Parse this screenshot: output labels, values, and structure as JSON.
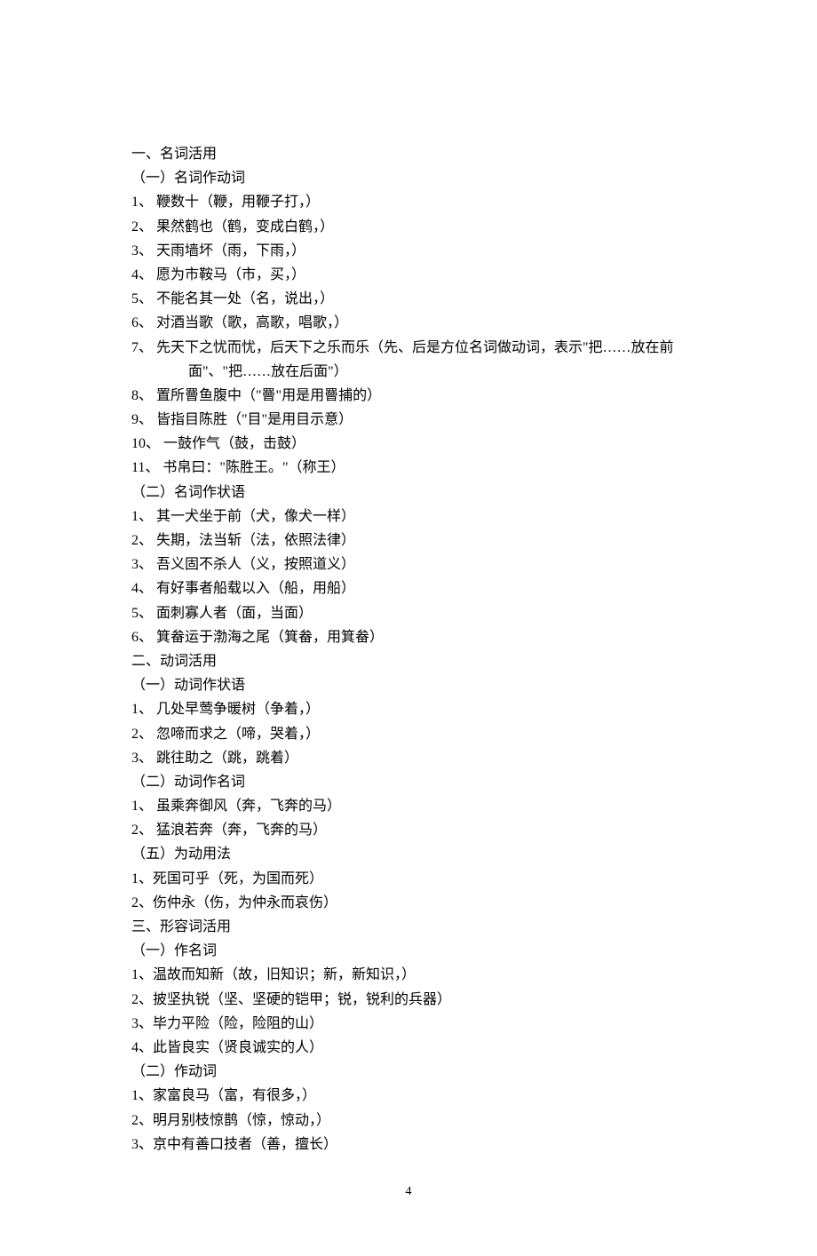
{
  "sections": [
    {
      "heading": "一、名词活用",
      "subsections": [
        {
          "heading": "（一）名词作动词",
          "items": [
            {
              "num": "1、",
              "text": "鞭数十（鞭，用鞭子打，）"
            },
            {
              "num": "2、",
              "text": "果然鹤也（鹤，变成白鹤，）"
            },
            {
              "num": "3、",
              "text": "天雨墙坏（雨，下雨，）"
            },
            {
              "num": "4、",
              "text": "愿为市鞍马（市，买，）"
            },
            {
              "num": "5、",
              "text": "不能名其一处（名，说出，）"
            },
            {
              "num": "6、",
              "text": "对酒当歌（歌，高歌，唱歌，）"
            },
            {
              "num": "7、",
              "text": "先天下之忧而忧，后天下之乐而乐（先、后是方位名词做动词，表示\"把……放在前",
              "cont": "面\"、\"把……放在后面\"）"
            },
            {
              "num": "8、",
              "text": "置所罾鱼腹中（\"罾\"用是用罾捕的）"
            },
            {
              "num": "9、",
              "text": "皆指目陈胜（\"目\"是用目示意）"
            },
            {
              "num": "10、",
              "text": "一鼓作气（鼓，击鼓）"
            },
            {
              "num": "11、",
              "text": "书帛曰：\"陈胜王。\"（称王）"
            }
          ]
        },
        {
          "heading": "（二）名词作状语",
          "items": [
            {
              "num": "1、",
              "text": "其一犬坐于前（犬，像犬一样）"
            },
            {
              "num": "2、",
              "text": "失期，法当斩（法，依照法律）"
            },
            {
              "num": "3、",
              "text": "吾义固不杀人（义，按照道义）"
            },
            {
              "num": "4、",
              "text": "有好事者船载以入（船，用船）"
            },
            {
              "num": "5、",
              "text": "面刺寡人者（面，当面）"
            },
            {
              "num": "6、",
              "text": "箕畚运于渤海之尾（箕畚，用箕畚）"
            }
          ]
        }
      ]
    },
    {
      "heading": "二、动词活用",
      "subsections": [
        {
          "heading": "（一）动词作状语",
          "items": [
            {
              "num": "1、",
              "text": "几处早莺争暖树（争着，）"
            },
            {
              "num": "2、",
              "text": "忽啼而求之（啼，哭着，）"
            },
            {
              "num": "3、",
              "text": "跳往助之（跳，跳着）"
            }
          ]
        },
        {
          "heading": "（二）动词作名词",
          "items": [
            {
              "num": "1、",
              "text": "虽乘奔御风（奔，飞奔的马）"
            },
            {
              "num": "2、",
              "text": "猛浪若奔（奔，飞奔的马）"
            }
          ]
        },
        {
          "heading": "（五）为动用法",
          "items": [
            {
              "num": "1、",
              "text": "死国可乎（死，为国而死）",
              "flat": true
            },
            {
              "num": "2、",
              "text": "伤仲永（伤，为仲永而哀伤）",
              "flat": true
            }
          ]
        }
      ]
    },
    {
      "heading": "三、形容词活用",
      "subsections": [
        {
          "heading": "（一）作名词",
          "items": [
            {
              "num": "1、",
              "text": "温故而知新（故，旧知识；新，新知识，）",
              "flat": true
            },
            {
              "num": "2、",
              "text": "披坚执锐（坚、坚硬的铠甲；锐，锐利的兵器）",
              "flat": true
            },
            {
              "num": "3、",
              "text": "毕力平险（险，险阻的山）",
              "flat": true
            },
            {
              "num": "4、",
              "text": "此皆良实（贤良诚实的人）",
              "flat": true
            }
          ]
        },
        {
          "heading": "（二）作动词",
          "items": [
            {
              "num": "1、",
              "text": "家富良马（富，有很多，）",
              "flat": true
            },
            {
              "num": "2、",
              "text": "明月别枝惊鹊（惊，惊动，）",
              "flat": true
            },
            {
              "num": "3、",
              "text": "京中有善口技者（善，擅长）",
              "flat": true
            }
          ]
        }
      ]
    }
  ],
  "page_number": "4"
}
